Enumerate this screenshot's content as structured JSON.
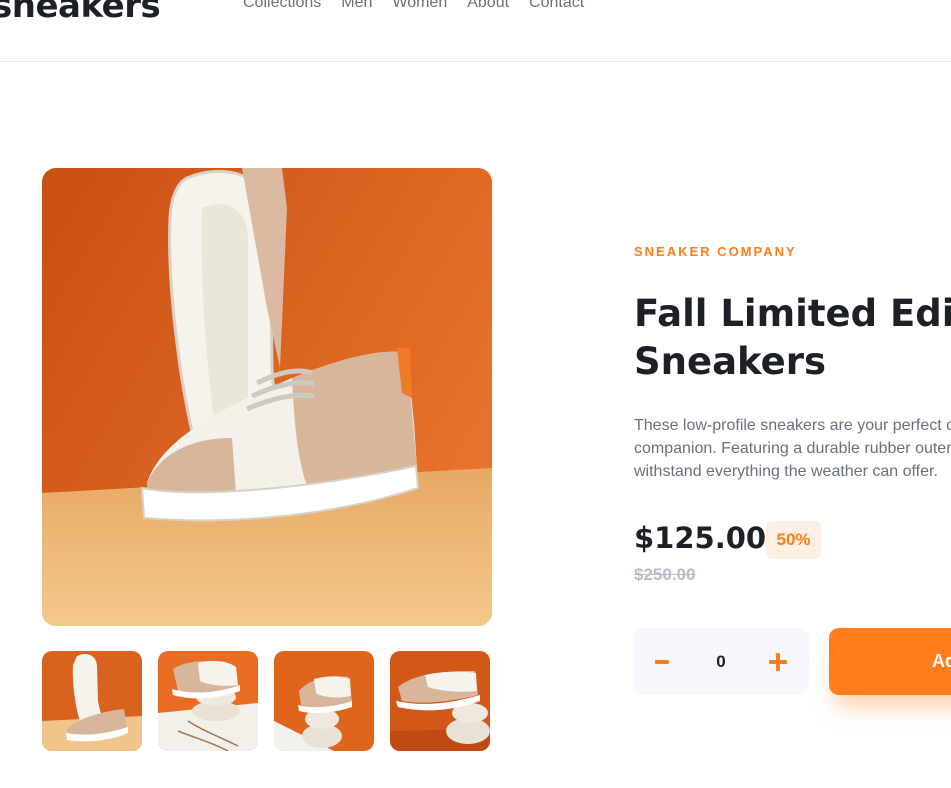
{
  "header": {
    "logo": "sneakers",
    "nav": [
      "Collections",
      "Men",
      "Women",
      "About",
      "Contact"
    ]
  },
  "product": {
    "company": "SNEAKER COMPANY",
    "title_line1": "Fall Limited Edition",
    "title_line2": "Sneakers",
    "description_lines": [
      "These low-profile sneakers are your perfect casual wear",
      "companion. Featuring a durable rubber outer sole, they'll",
      "withstand everything the weather can offer."
    ],
    "price": "$125.00",
    "discount": "50%",
    "original_price": "$250.00"
  },
  "cart": {
    "quantity": "0",
    "add_label": "Add to cart"
  },
  "gallery": {
    "thumbnail_count": 4
  },
  "colors": {
    "accent": "#ff7d1a",
    "accent_pale": "#ffeee2",
    "text_dark": "#1d2026",
    "text_gray": "#69707d"
  }
}
